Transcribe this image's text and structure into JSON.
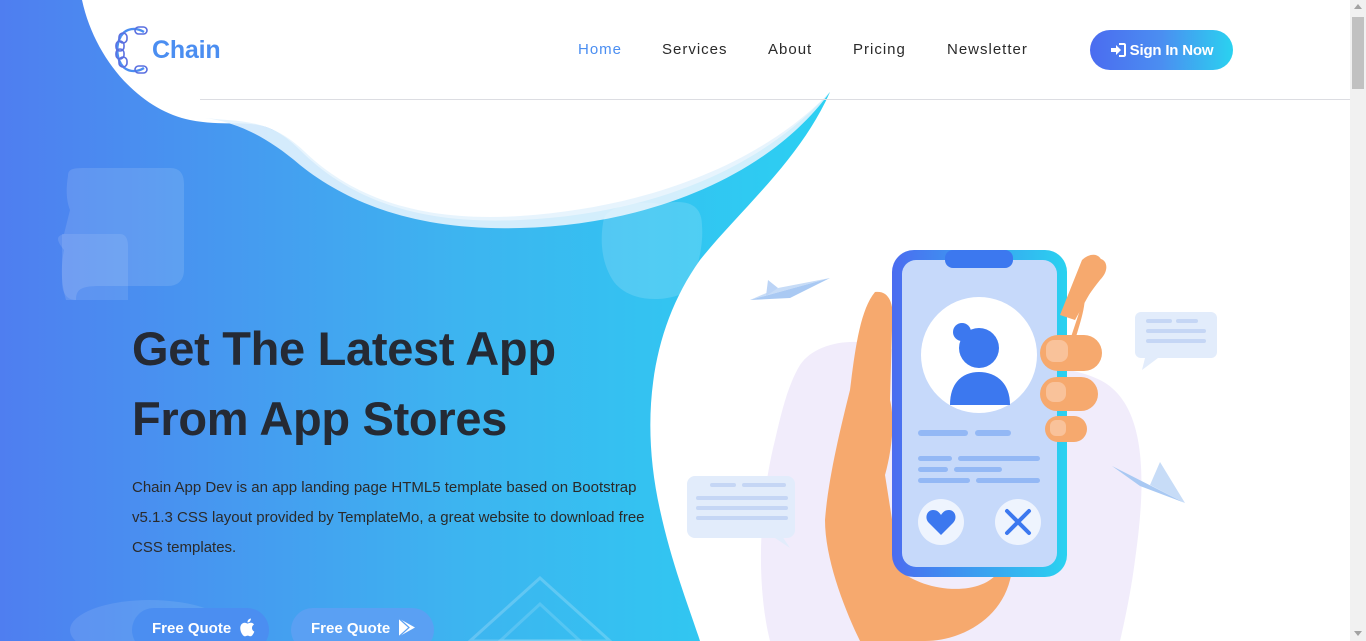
{
  "header": {
    "logo_text": "Chain",
    "nav": [
      {
        "label": "Home",
        "active": true
      },
      {
        "label": "Services",
        "active": false
      },
      {
        "label": "About",
        "active": false
      },
      {
        "label": "Pricing",
        "active": false
      },
      {
        "label": "Newsletter",
        "active": false
      }
    ],
    "signin_label": "Sign In Now",
    "signin_icon": "sign-in-icon"
  },
  "hero": {
    "title_line1": "Get The Latest App",
    "title_line2": "From App Stores",
    "description": "Chain App Dev is an app landing page HTML5 template based on Bootstrap v5.1.3 CSS layout provided by TemplateMo, a great website to download free CSS templates.",
    "buttons": [
      {
        "label": "Free Quote",
        "icon": "apple-icon"
      },
      {
        "label": "Free Quote",
        "icon": "google-play-icon"
      }
    ]
  },
  "colors": {
    "accent": "#4b8ef1",
    "gradient_start": "#4b6cf0",
    "gradient_end": "#2ad2f0",
    "heading": "#252a34",
    "text": "#2a2a2a"
  }
}
